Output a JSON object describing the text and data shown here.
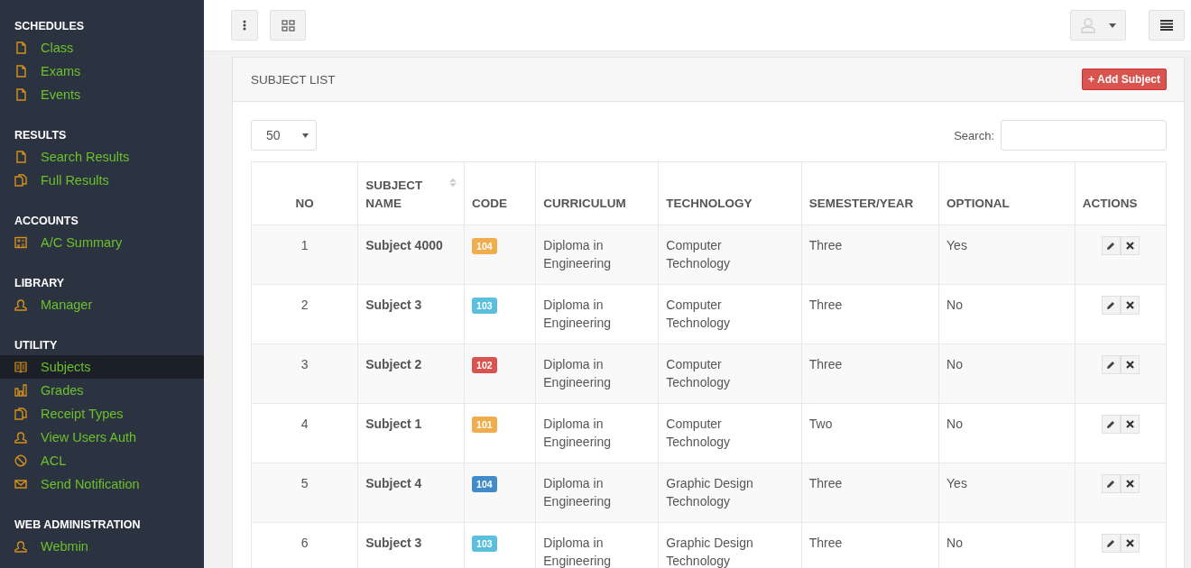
{
  "sidebar": {
    "sections": [
      {
        "title": "SCHEDULES",
        "items": [
          {
            "label": "Class",
            "kind": "file",
            "selected": false
          },
          {
            "label": "Exams",
            "kind": "file",
            "selected": false
          },
          {
            "label": "Events",
            "kind": "file",
            "selected": false
          }
        ]
      },
      {
        "title": "RESULTS",
        "items": [
          {
            "label": "Search Results",
            "kind": "file",
            "selected": false
          },
          {
            "label": "Full Results",
            "kind": "files",
            "selected": false
          }
        ]
      },
      {
        "title": "ACCOUNTS",
        "items": [
          {
            "label": "A/C Summary",
            "kind": "calc",
            "selected": false
          }
        ]
      },
      {
        "title": "LIBRARY",
        "items": [
          {
            "label": "Manager",
            "kind": "user",
            "selected": false
          }
        ]
      },
      {
        "title": "UTILITY",
        "items": [
          {
            "label": "Subjects",
            "kind": "book",
            "selected": true
          },
          {
            "label": "Grades",
            "kind": "chart",
            "selected": false
          },
          {
            "label": "Receipt Types",
            "kind": "files",
            "selected": false
          },
          {
            "label": "View Users Auth",
            "kind": "user",
            "selected": false
          },
          {
            "label": "ACL",
            "kind": "ban",
            "selected": false
          },
          {
            "label": "Send Notification",
            "kind": "mail",
            "selected": false
          }
        ]
      },
      {
        "title": "WEB ADMINISTRATION",
        "items": [
          {
            "label": "Webmin",
            "kind": "user",
            "selected": false
          }
        ]
      }
    ]
  },
  "panel": {
    "title": "SUBJECT LIST",
    "add_button": "+ Add Subject",
    "page_size": "50",
    "search_label": "Search:",
    "table": {
      "columns": [
        "NO",
        "SUBJECT NAME",
        "CODE",
        "CURRICULUM",
        "TECHNOLOGY",
        "SEMESTER/YEAR",
        "OPTIONAL",
        "ACTIONS"
      ],
      "rows": [
        {
          "no": "1",
          "name": "Subject 4000",
          "code": "104",
          "color": "#f0ad4e",
          "curriculum": "Diploma in Engineering",
          "technology": "Computer Technology",
          "semester": "Three",
          "optional": "Yes"
        },
        {
          "no": "2",
          "name": "Subject 3",
          "code": "103",
          "color": "#5bc0de",
          "curriculum": "Diploma in Engineering",
          "technology": "Computer Technology",
          "semester": "Three",
          "optional": "No"
        },
        {
          "no": "3",
          "name": "Subject 2",
          "code": "102",
          "color": "#d9534f",
          "curriculum": "Diploma in Engineering",
          "technology": "Computer Technology",
          "semester": "Three",
          "optional": "No"
        },
        {
          "no": "4",
          "name": "Subject 1",
          "code": "101",
          "color": "#f0ad4e",
          "curriculum": "Diploma in Engineering",
          "technology": "Computer Technology",
          "semester": "Two",
          "optional": "No"
        },
        {
          "no": "5",
          "name": "Subject 4",
          "code": "104",
          "color": "#428bca",
          "curriculum": "Diploma in Engineering",
          "technology": "Graphic Design Technology",
          "semester": "Three",
          "optional": "Yes"
        },
        {
          "no": "6",
          "name": "Subject 3",
          "code": "103",
          "color": "#5bc0de",
          "curriculum": "Diploma in Engineering",
          "technology": "Graphic Design Technology",
          "semester": "Three",
          "optional": "No"
        }
      ]
    }
  }
}
